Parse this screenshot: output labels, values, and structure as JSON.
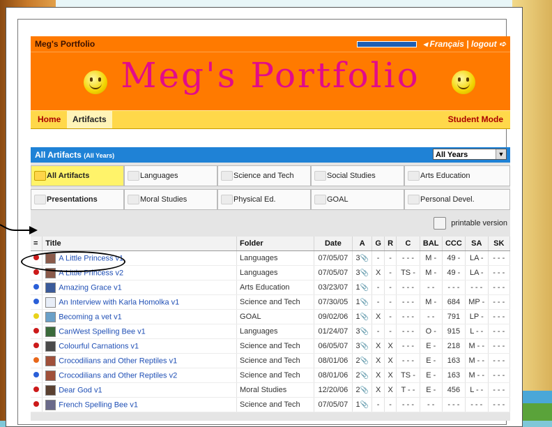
{
  "header": {
    "portfolio_name": "Meg's Portfolio",
    "language_link": "Français",
    "separator": "|",
    "logout_link": "logout",
    "banner_title": "Meg's Portfolio"
  },
  "nav": {
    "home": "Home",
    "artifacts": "Artifacts",
    "student_mode": "Student Mode"
  },
  "panel": {
    "title": "All Artifacts",
    "title_sub": "(All Years)",
    "year_select": "All Years",
    "tabs": [
      {
        "label": "All Artifacts",
        "active": true
      },
      {
        "label": "Languages"
      },
      {
        "label": "Science and Tech"
      },
      {
        "label": "Social Studies"
      },
      {
        "label": "Arts Education"
      },
      {
        "label": "Presentations",
        "bold": true
      },
      {
        "label": "Moral Studies"
      },
      {
        "label": "Physical Ed."
      },
      {
        "label": "GOAL"
      },
      {
        "label": "Personal Devel."
      }
    ],
    "printable": "printable version"
  },
  "table": {
    "headers": [
      "=",
      "Title",
      "Folder",
      "Date",
      "A",
      "G",
      "R",
      "C",
      "BAL",
      "CCC",
      "SA",
      "SK"
    ],
    "rows": [
      {
        "dot": "#cc1a1a",
        "thumb": "#8a5a4a",
        "title": "A Little Princess v1",
        "folder": "Languages",
        "date": "07/05/07",
        "a": "3",
        "g": "-",
        "r": "-",
        "c": "- - -",
        "bal": "M -",
        "ccc": "49 -",
        "sa": "LA -",
        "sk": "- - -"
      },
      {
        "dot": "#cc1a1a",
        "thumb": "#8a5a4a",
        "title": "A Little Princess v2",
        "folder": "Languages",
        "date": "07/05/07",
        "a": "3",
        "g": "X",
        "r": "-",
        "c": "TS -",
        "bal": "M -",
        "ccc": "49 -",
        "sa": "LA -",
        "sk": "- - -"
      },
      {
        "dot": "#2a5fd8",
        "thumb": "#3a5a9a",
        "title": "Amazing Grace v1",
        "folder": "Arts Education",
        "date": "03/23/07",
        "a": "1",
        "g": "-",
        "r": "-",
        "c": "- - -",
        "bal": "- -",
        "ccc": "- - -",
        "sa": "- - -",
        "sk": "- - -"
      },
      {
        "dot": "#2a5fd8",
        "thumb": "#e8eef8",
        "title": "An Interview with Karla Homolka v1",
        "folder": "Science and Tech",
        "date": "07/30/05",
        "a": "1",
        "g": "-",
        "r": "-",
        "c": "- - -",
        "bal": "M -",
        "ccc": "684",
        "sa": "MP -",
        "sk": "- - -"
      },
      {
        "dot": "#e8d21a",
        "thumb": "#6aa0c8",
        "title": "Becoming a vet v1",
        "folder": "GOAL",
        "date": "09/02/06",
        "a": "1",
        "g": "X",
        "r": "-",
        "c": "- - -",
        "bal": "- -",
        "ccc": "791",
        "sa": "LP -",
        "sk": "- - -"
      },
      {
        "dot": "#cc1a1a",
        "thumb": "#3a6a3a",
        "title": "CanWest Spelling Bee v1",
        "folder": "Languages",
        "date": "01/24/07",
        "a": "3",
        "g": "-",
        "r": "-",
        "c": "- - -",
        "bal": "O -",
        "ccc": "915",
        "sa": "L - -",
        "sk": "- - -"
      },
      {
        "dot": "#cc1a1a",
        "thumb": "#4a4a4a",
        "title": "Colourful Carnations v1",
        "folder": "Science and Tech",
        "date": "06/05/07",
        "a": "3",
        "g": "X",
        "r": "X",
        "c": "- - -",
        "bal": "E -",
        "ccc": "218",
        "sa": "M - -",
        "sk": "- - -"
      },
      {
        "dot": "#e8671a",
        "thumb": "#a0503a",
        "title": "Crocodilians and Other Reptiles v1",
        "folder": "Science and Tech",
        "date": "08/01/06",
        "a": "2",
        "g": "X",
        "r": "X",
        "c": "- - -",
        "bal": "E -",
        "ccc": "163",
        "sa": "M - -",
        "sk": "- - -"
      },
      {
        "dot": "#2a5fd8",
        "thumb": "#a0503a",
        "title": "Crocodilians and Other Reptiles v2",
        "folder": "Science and Tech",
        "date": "08/01/06",
        "a": "2",
        "g": "X",
        "r": "X",
        "c": "TS -",
        "bal": "E -",
        "ccc": "163",
        "sa": "M - -",
        "sk": "- - -"
      },
      {
        "dot": "#cc1a1a",
        "thumb": "#5a4030",
        "title": "Dear God v1",
        "folder": "Moral Studies",
        "date": "12/20/06",
        "a": "2",
        "g": "X",
        "r": "X",
        "c": "T - -",
        "bal": "E -",
        "ccc": "456",
        "sa": "L - -",
        "sk": "- - -"
      },
      {
        "dot": "#cc1a1a",
        "thumb": "#6a6a8a",
        "title": "French Spelling Bee v1",
        "folder": "Science and Tech",
        "date": "07/05/07",
        "a": "1",
        "g": "-",
        "r": "-",
        "c": "- - -",
        "bal": "- -",
        "ccc": "- - -",
        "sa": "- - -",
        "sk": "- - -"
      }
    ]
  }
}
